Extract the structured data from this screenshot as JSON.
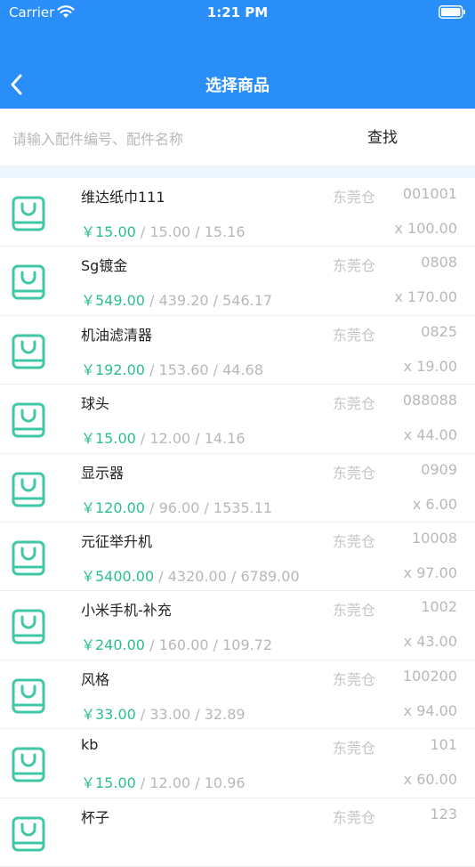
{
  "status_bar": {
    "carrier": "Carrier",
    "time": "1:21 PM"
  },
  "nav": {
    "title": "选择商品"
  },
  "search": {
    "placeholder": "请输入配件编号、配件名称",
    "button": "查找"
  },
  "colors": {
    "accent": "#2a8ef8",
    "price": "#2bbf8f",
    "icon": "#3fc7a6"
  },
  "items": [
    {
      "name": "维达纸巾111",
      "warehouse": "东莞仓",
      "code": "001001",
      "price": "￥15.00",
      "others": " / 15.00 / 15.16",
      "qty": "x 100.00"
    },
    {
      "name": "Sg镀金",
      "warehouse": "东莞仓",
      "code": "0808",
      "price": "￥549.00",
      "others": " / 439.20 / 546.17",
      "qty": "x 170.00"
    },
    {
      "name": "机油滤清器",
      "warehouse": "东莞仓",
      "code": "0825",
      "price": "￥192.00",
      "others": " / 153.60 / 44.68",
      "qty": "x 19.00"
    },
    {
      "name": "球头",
      "warehouse": "东莞仓",
      "code": "088088",
      "price": "￥15.00",
      "others": " / 12.00 / 14.16",
      "qty": "x 44.00"
    },
    {
      "name": "显示器",
      "warehouse": "东莞仓",
      "code": "0909",
      "price": "￥120.00",
      "others": " / 96.00 / 1535.11",
      "qty": "x 6.00"
    },
    {
      "name": "元征举升机",
      "warehouse": "东莞仓",
      "code": "10008",
      "price": "￥5400.00",
      "others": " / 4320.00 / 6789.00",
      "qty": "x 97.00"
    },
    {
      "name": "小米手机-补充",
      "warehouse": "东莞仓",
      "code": "1002",
      "price": "￥240.00",
      "others": " / 160.00 / 109.72",
      "qty": "x 43.00"
    },
    {
      "name": "风格",
      "warehouse": "东莞仓",
      "code": "100200",
      "price": "￥33.00",
      "others": " / 33.00 / 32.89",
      "qty": "x 94.00"
    },
    {
      "name": "kb",
      "warehouse": "东莞仓",
      "code": "101",
      "price": "￥15.00",
      "others": " / 12.00 / 10.96",
      "qty": "x 60.00"
    },
    {
      "name": "杯子",
      "warehouse": "东莞仓",
      "code": "123",
      "price": "",
      "others": "",
      "qty": ""
    }
  ]
}
